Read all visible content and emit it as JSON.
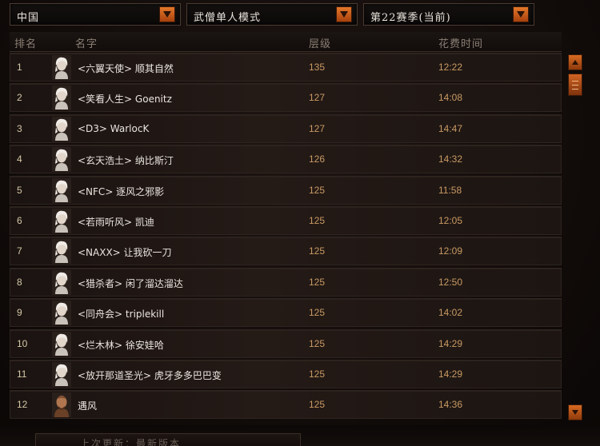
{
  "filters": {
    "region": "中国",
    "mode": "武僧单人模式",
    "season": "第22赛季(当前)"
  },
  "columns": {
    "rank": "排名",
    "name": "名字",
    "level": "层级",
    "time": "花费时间"
  },
  "rows": [
    {
      "rank": "1",
      "name": "<六翼天使> 顺其自然",
      "level": "135",
      "time": "12:22",
      "avatar": "female"
    },
    {
      "rank": "2",
      "name": "<笑看人生> Goenitz",
      "level": "127",
      "time": "14:08",
      "avatar": "female"
    },
    {
      "rank": "3",
      "name": "<D3> WarlocK",
      "level": "127",
      "time": "14:47",
      "avatar": "female"
    },
    {
      "rank": "4",
      "name": "<玄天浩土> 纳比斯汀",
      "level": "126",
      "time": "14:32",
      "avatar": "female"
    },
    {
      "rank": "5",
      "name": "<NFC> 逐风之邪影",
      "level": "125",
      "time": "11:58",
      "avatar": "female"
    },
    {
      "rank": "6",
      "name": "<若雨听风> 凯迪",
      "level": "125",
      "time": "12:05",
      "avatar": "female"
    },
    {
      "rank": "7",
      "name": "<NAXX> 让我砍一刀",
      "level": "125",
      "time": "12:09",
      "avatar": "female"
    },
    {
      "rank": "8",
      "name": "<猎杀者> 闲了溜达溜达",
      "level": "125",
      "time": "12:50",
      "avatar": "female"
    },
    {
      "rank": "9",
      "name": "<同舟会> triplekill",
      "level": "125",
      "time": "14:02",
      "avatar": "female"
    },
    {
      "rank": "10",
      "name": "<烂木林> 徐安娃哈",
      "level": "125",
      "time": "14:29",
      "avatar": "female"
    },
    {
      "rank": "11",
      "name": "<放开那道圣光> 虎牙多多巴巴变",
      "level": "125",
      "time": "14:29",
      "avatar": "female"
    },
    {
      "rank": "12",
      "name": "遇风",
      "level": "125",
      "time": "14:36",
      "avatar": "male"
    }
  ],
  "footer": {
    "text": "上次更新：最新版本"
  },
  "icons": {
    "dropdown": "chevron-down-icon",
    "scroll_up": "arrow-up-icon",
    "scroll_down": "arrow-down-icon",
    "avatar_female": "monk-female-avatar-icon",
    "avatar_male": "monk-male-avatar-icon"
  },
  "colors": {
    "accent": "#c8561a",
    "value_text": "#c99a63",
    "name_text": "#e9e4de"
  }
}
